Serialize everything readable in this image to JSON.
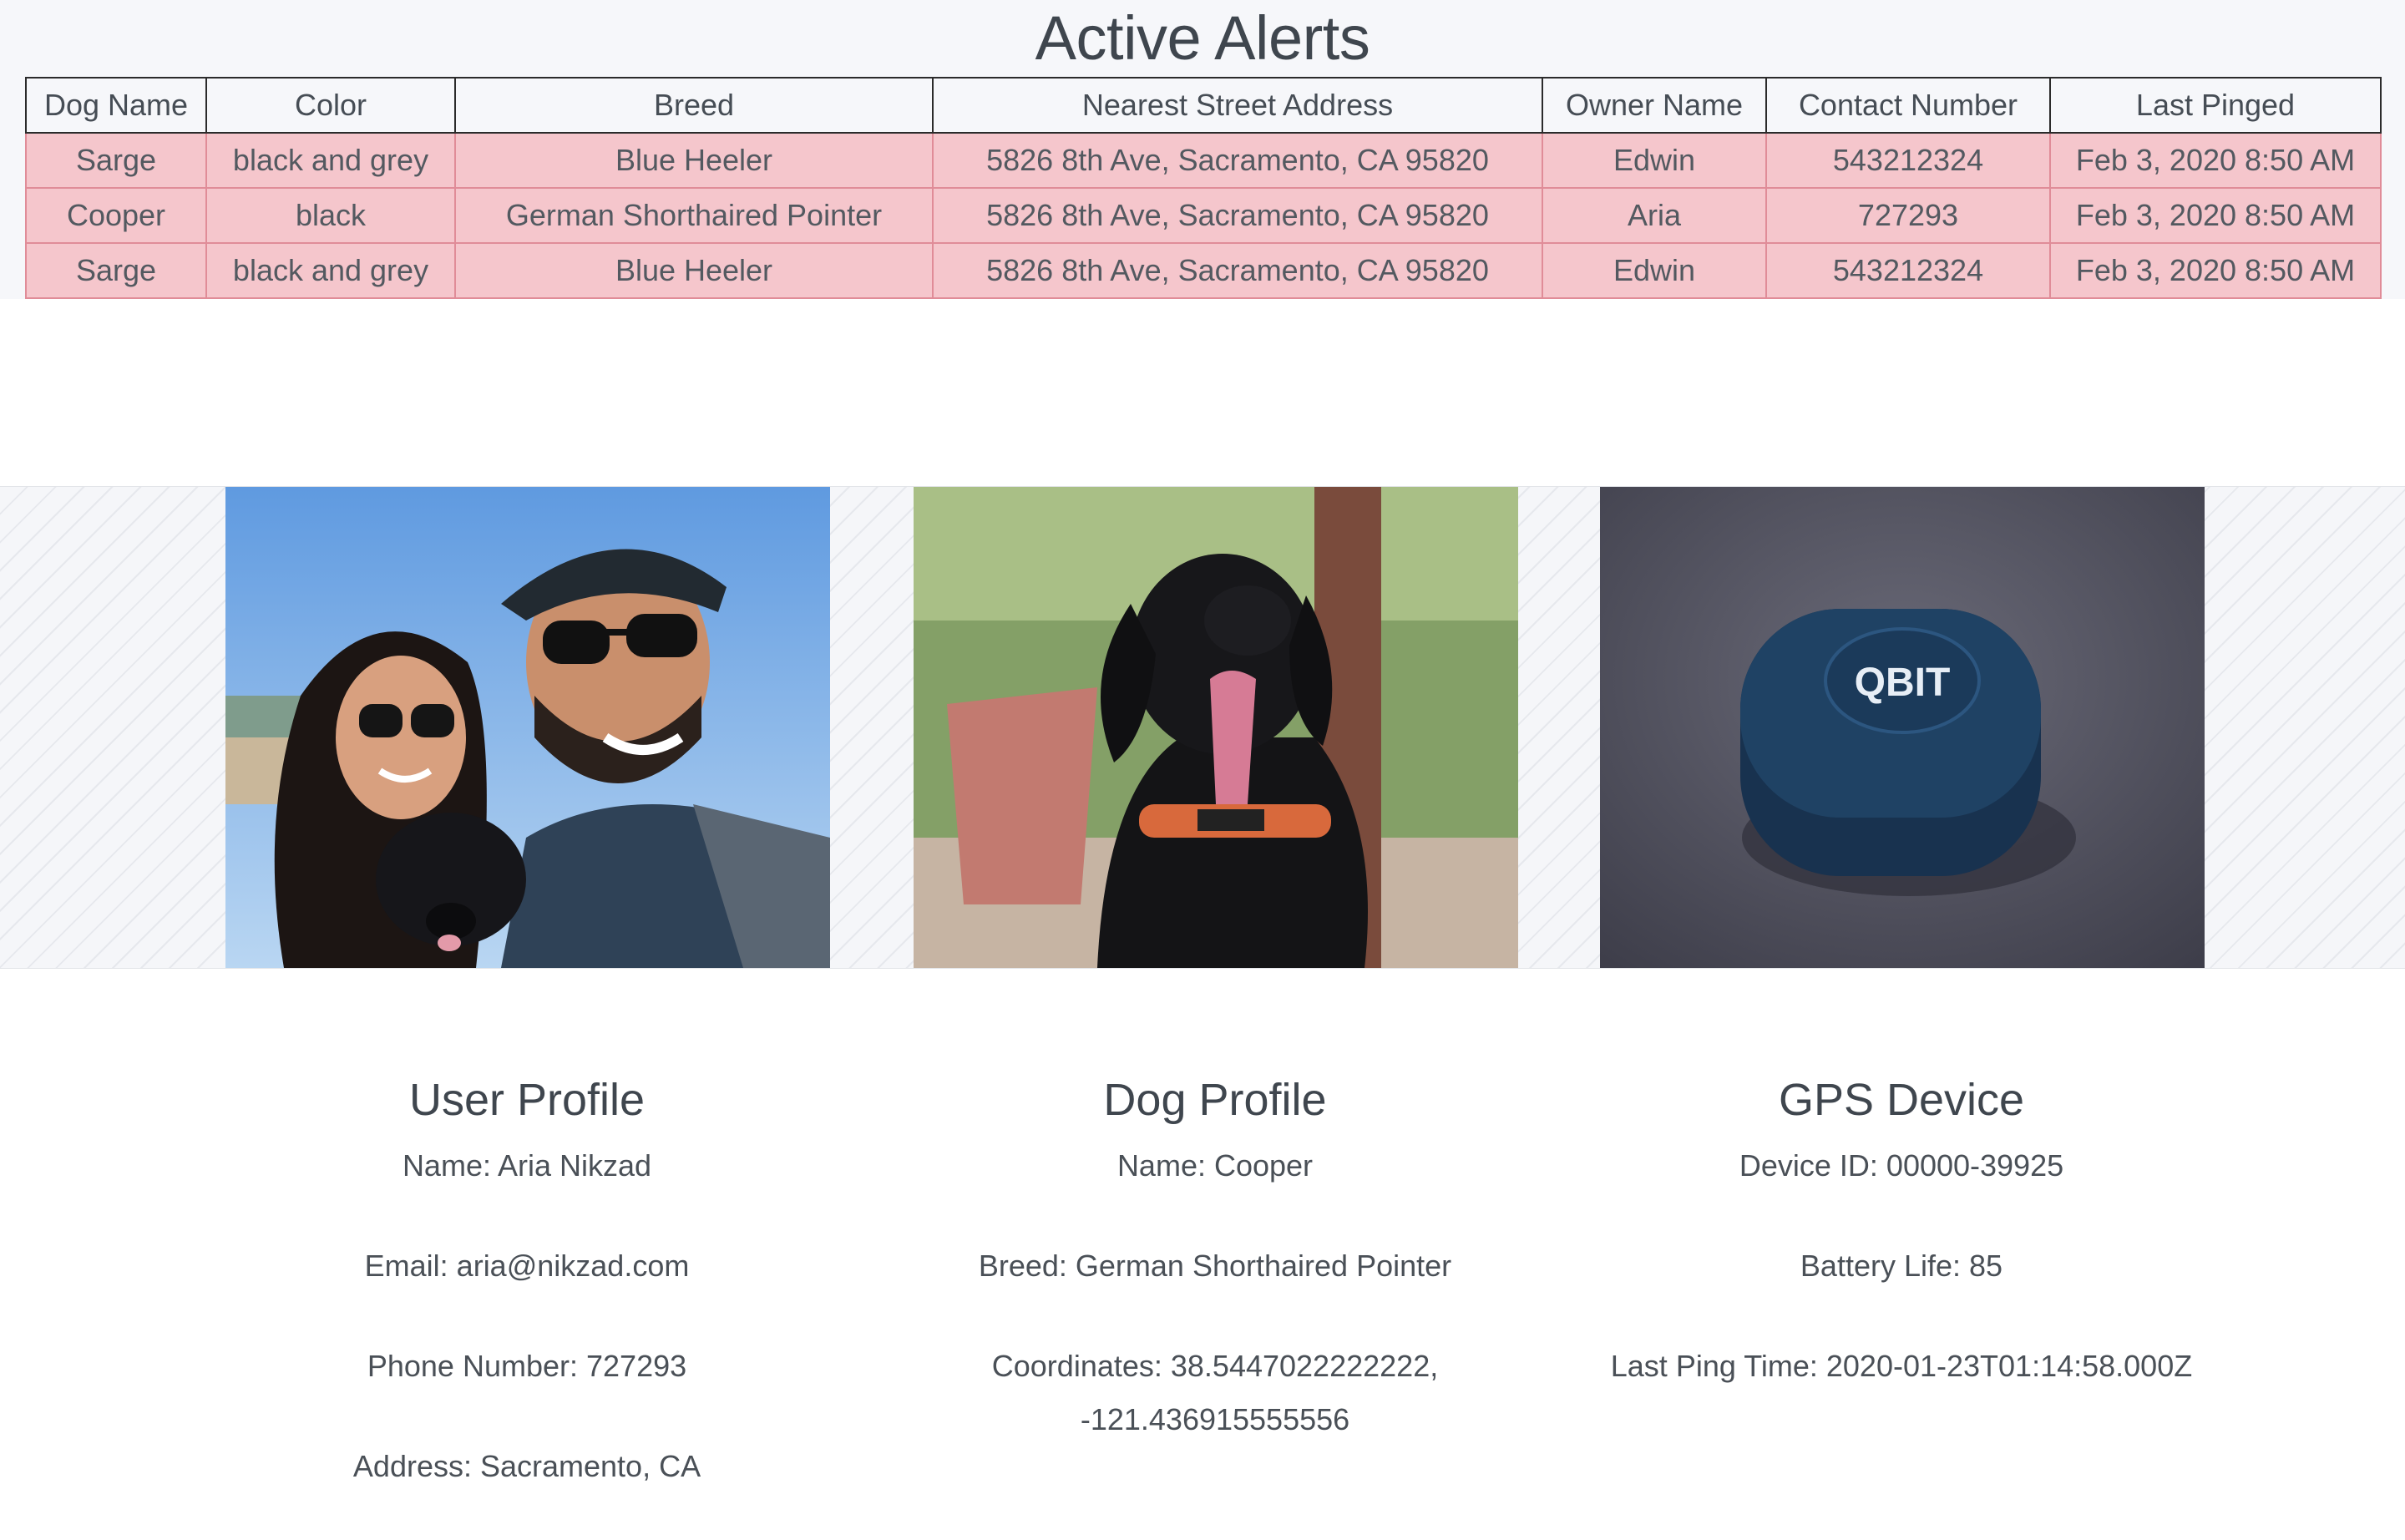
{
  "page_title": "Active Alerts",
  "alerts_table": {
    "columns": [
      "Dog Name",
      "Color",
      "Breed",
      "Nearest Street Address",
      "Owner Name",
      "Contact Number",
      "Last Pinged"
    ],
    "rows": [
      [
        "Sarge",
        "black and grey",
        "Blue Heeler",
        "5826 8th Ave, Sacramento, CA 95820",
        "Edwin",
        "543212324",
        "Feb 3, 2020 8:50 AM"
      ],
      [
        "Cooper",
        "black",
        "German Shorthaired Pointer",
        "5826 8th Ave, Sacramento, CA 95820",
        "Aria",
        "727293",
        "Feb 3, 2020 8:50 AM"
      ],
      [
        "Sarge",
        "black and grey",
        "Blue Heeler",
        "5826 8th Ave, Sacramento, CA 95820",
        "Edwin",
        "543212324",
        "Feb 3, 2020 8:50 AM"
      ]
    ]
  },
  "gallery": {
    "device_logo_text": "QBIT"
  },
  "user_profile": {
    "heading": "User Profile",
    "name": "Name: Aria Nikzad",
    "email": "Email: aria@nikzad.com",
    "phone": "Phone Number: 727293",
    "address": "Address: Sacramento, CA"
  },
  "dog_profile": {
    "heading": "Dog Profile",
    "name": "Name: Cooper",
    "breed": "Breed: German Shorthaired Pointer",
    "coordinates": "Coordinates: 38.5447022222222, -121.436915555556"
  },
  "gps_device": {
    "heading": "GPS Device",
    "device_id": "Device ID: 00000-39925",
    "battery": "Battery Life: 85",
    "last_ping": "Last Ping Time: 2020-01-23T01:14:58.000Z"
  },
  "colors": {
    "alert_row_bg": "#f5c6cc",
    "alert_row_border": "#e08c98",
    "header_border": "#2b2b2b",
    "band_bg": "#f6f7fa"
  }
}
